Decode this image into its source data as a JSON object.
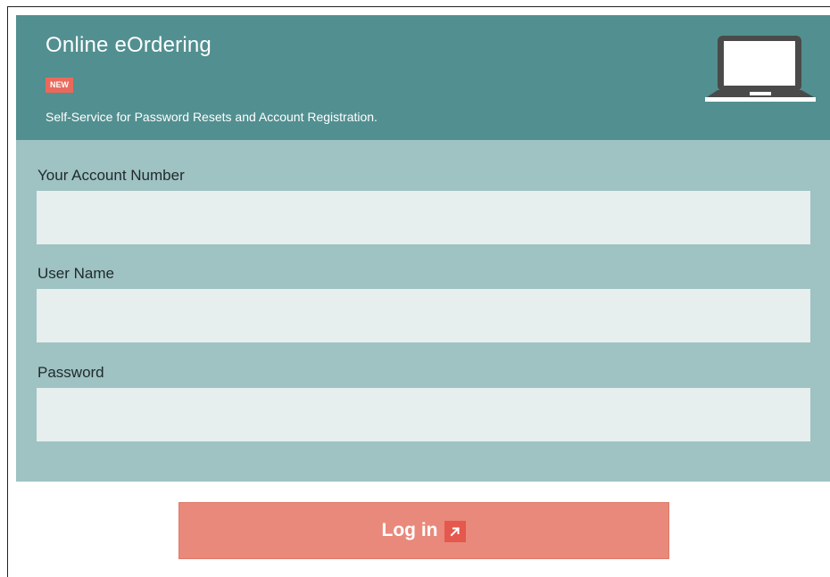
{
  "header": {
    "title": "Online eOrdering",
    "badge": "NEW",
    "subtitle": "Self-Service for Password Resets and Account Registration.",
    "icon": "laptop-icon"
  },
  "form": {
    "account_number": {
      "label": "Your Account Number",
      "value": ""
    },
    "user_name": {
      "label": "User Name",
      "value": ""
    },
    "password": {
      "label": "Password",
      "value": ""
    }
  },
  "login": {
    "label": "Log in",
    "icon": "external-arrow-icon"
  },
  "colors": {
    "header_bg": "#528f90",
    "panel_bg": "#9fc2c3",
    "input_bg": "#e6eeee",
    "badge_bg": "#e96a5c",
    "button_bg": "#e9897b",
    "button_icon_bg": "#e5584d"
  }
}
